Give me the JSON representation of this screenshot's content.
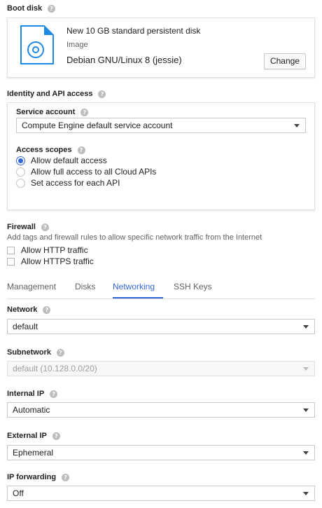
{
  "boot_disk": {
    "title": "Boot disk",
    "help": "?",
    "disk_name": "New 10 GB standard persistent disk",
    "image_label": "Image",
    "image_value": "Debian GNU/Linux 8 (jessie)",
    "change_button": "Change",
    "icon": "disk-icon"
  },
  "identity": {
    "title": "Identity and API access",
    "help": "?",
    "service_account_label": "Service account",
    "service_account_value": "Compute Engine default service account",
    "access_scopes_label": "Access scopes",
    "scopes": [
      {
        "label": "Allow default access",
        "checked": true
      },
      {
        "label": "Allow full access to all Cloud APIs",
        "checked": false
      },
      {
        "label": "Set access for each API",
        "checked": false
      }
    ]
  },
  "firewall": {
    "title": "Firewall",
    "help": "?",
    "description": "Add tags and firewall rules to allow specific network traffic from the Internet",
    "options": [
      {
        "label": "Allow HTTP traffic",
        "checked": false
      },
      {
        "label": "Allow HTTPS traffic",
        "checked": false
      }
    ]
  },
  "tabs": {
    "items": [
      "Management",
      "Disks",
      "Networking",
      "SSH Keys"
    ],
    "active": "Networking"
  },
  "networking": {
    "network_label": "Network",
    "network_value": "default",
    "subnetwork_label": "Subnetwork",
    "subnetwork_value": "default (10.128.0.0/20)",
    "internal_ip_label": "Internal IP",
    "internal_ip_value": "Automatic",
    "external_ip_label": "External IP",
    "external_ip_value": "Ephemeral",
    "ip_forwarding_label": "IP forwarding",
    "ip_forwarding_value": "Off"
  },
  "colors": {
    "accent": "#3367d6",
    "disk_icon": "#1e88e5"
  }
}
